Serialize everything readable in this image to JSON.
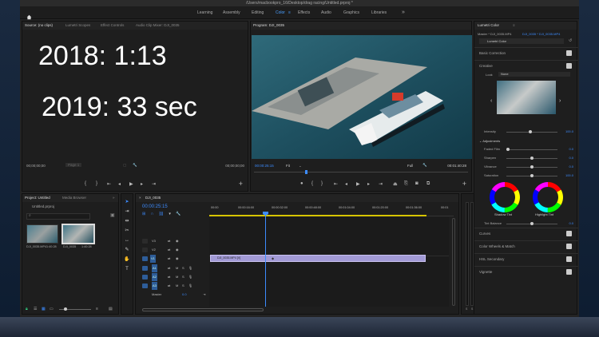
{
  "titlebar": {
    "path": "/Users/macbookpro_16/Desktop/drag racing/Untitled.prproj *"
  },
  "workspaces": {
    "items": [
      "Learning",
      "Assembly",
      "Editing",
      "Color",
      "Effects",
      "Audio",
      "Graphics",
      "Libraries"
    ],
    "active": "Color",
    "more": "»"
  },
  "source_panel": {
    "tabs": [
      "Source: (no clips)",
      "Lumetri Scopes",
      "Effect Controls",
      "Audio Clip Mixer: DJI_0035"
    ],
    "overlay_line1": "2018: 1:13",
    "overlay_line2": "2019: 33 sec",
    "timecode_left": "00;00;00;00",
    "page": "Page 1",
    "timecode_right": "00;00;00;00"
  },
  "program_panel": {
    "tab": "Program: DJI_0035",
    "timecode": "00:00:25:15",
    "fit": "Fit",
    "quality": "Full",
    "duration": "00:01:40:28"
  },
  "project_panel": {
    "tabs": [
      "Project: Untitled",
      "Media Browser"
    ],
    "project_file": "Untitled.prproj",
    "clips": [
      {
        "name": "DJI_0035.MP4",
        "duration": "1:40:28"
      },
      {
        "name": "DJI_0035",
        "duration": "1:40:28"
      }
    ]
  },
  "timeline": {
    "tab": "DJI_0035",
    "timecode": "00:00:25:15",
    "ruler": [
      "00:00",
      "00:00:16:00",
      "00:00:32:00",
      "00:00:48:00",
      "00:01:04:00",
      "00:01:20:00",
      "00:01:36:00",
      "00:01"
    ],
    "video_tracks": [
      "V3",
      "V2",
      "V1"
    ],
    "audio_tracks": [
      "A1",
      "A2",
      "A3"
    ],
    "master_label": "Master",
    "master_value": "0.0",
    "clip_name": "DJI_0035.MP4 [V]"
  },
  "meters": {
    "labels": [
      "0",
      "-6",
      "-12",
      "-18",
      "-24",
      "-30",
      "-36",
      "-42",
      "-48",
      "-54"
    ],
    "bottom": [
      "S",
      "S"
    ]
  },
  "lumetri": {
    "tab": "Lumetri Color",
    "master_label": "Master * DJI_0035.MP4",
    "clip_label": "DJI_0035 * DJI_0035.MP4",
    "effect_select": "Lumetri Color",
    "sections": {
      "basic": "Basic Correction",
      "creative": "Creative",
      "look_label": "Look",
      "look_value": "None",
      "intensity_label": "Intensity",
      "intensity_value": "100.0",
      "adjustments": "Adjustments",
      "curves": "Curves",
      "color_wheels": "Color Wheels & Match",
      "hsl": "HSL Secondary",
      "vignette": "Vignette"
    },
    "adjust": [
      {
        "label": "Faded Film",
        "value": "0.0"
      },
      {
        "label": "Sharpen",
        "value": "0.0"
      },
      {
        "label": "Vibrance",
        "value": "0.0"
      },
      {
        "label": "Saturation",
        "value": "100.0"
      }
    ],
    "shadow_tint": "Shadow Tint",
    "highlight_tint": "Highlight Tint",
    "tint_balance_label": "Tint Balance",
    "tint_balance_value": "0.0"
  },
  "colors": {
    "accent": "#3d8cff",
    "clip": "#a29ad6",
    "playhead": "#3d8cff",
    "panel": "#1e1e1e"
  }
}
